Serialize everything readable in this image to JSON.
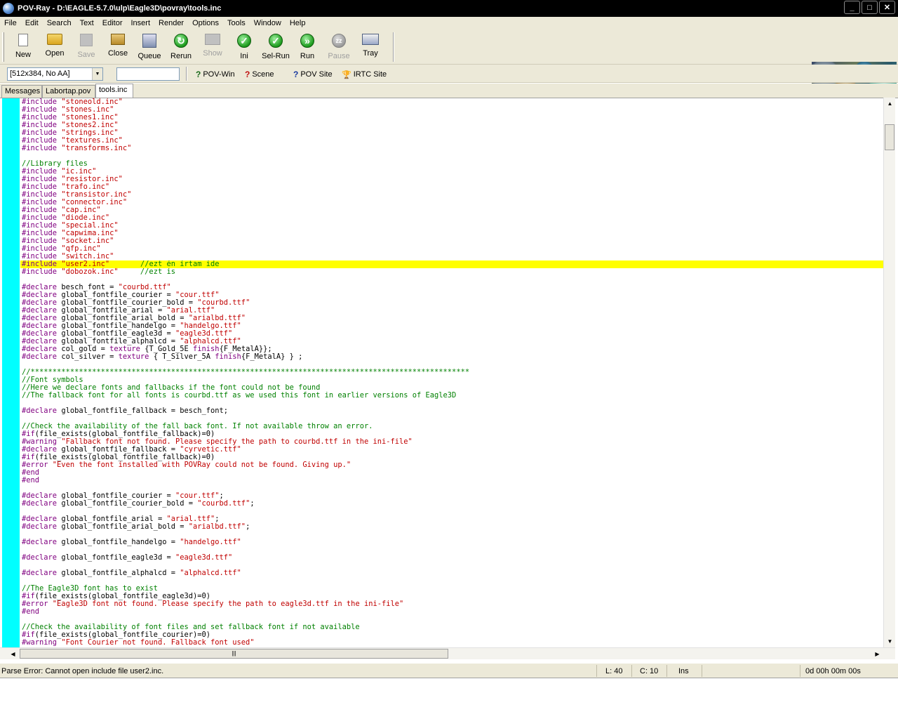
{
  "window": {
    "title": "POV-Ray - D:\\EAGLE-5.7.0\\ulp\\Eagle3D\\povray\\tools.inc",
    "controls": [
      "_",
      "□",
      "✕"
    ]
  },
  "menu": [
    "File",
    "Edit",
    "Search",
    "Text",
    "Editor",
    "Insert",
    "Render",
    "Options",
    "Tools",
    "Window",
    "Help"
  ],
  "toolbar": {
    "new": "New",
    "open": "Open",
    "save": "Save",
    "close": "Close",
    "queue": "Queue",
    "rerun": "Rerun",
    "show": "Show",
    "ini": "Ini",
    "selrun": "Sel-Run",
    "run": "Run",
    "pause": "Pause",
    "tray": "Tray"
  },
  "toolbar2": {
    "resolution": "[512x384, No AA]",
    "command_value": "",
    "povwin": "POV-Win",
    "scene": "Scene",
    "povsite": "POV Site",
    "irtcsite": "IRTC Site"
  },
  "tabs": [
    "Messages",
    "Labortap.pov",
    "tools.inc"
  ],
  "code_lines": [
    [
      [
        "kw",
        "#include "
      ],
      [
        "str",
        "\"stoneold.inc\""
      ]
    ],
    [
      [
        "kw",
        "#include "
      ],
      [
        "str",
        "\"stones.inc\""
      ]
    ],
    [
      [
        "kw",
        "#include "
      ],
      [
        "str",
        "\"stones1.inc\""
      ]
    ],
    [
      [
        "kw",
        "#include "
      ],
      [
        "str",
        "\"stones2.inc\""
      ]
    ],
    [
      [
        "kw",
        "#include "
      ],
      [
        "str",
        "\"strings.inc\""
      ]
    ],
    [
      [
        "kw",
        "#include "
      ],
      [
        "str",
        "\"textures.inc\""
      ]
    ],
    [
      [
        "kw",
        "#include "
      ],
      [
        "str",
        "\"transforms.inc\""
      ]
    ],
    [],
    [
      [
        "cmt",
        "//Library files"
      ]
    ],
    [
      [
        "kw",
        "#include "
      ],
      [
        "str",
        "\"ic.inc\""
      ]
    ],
    [
      [
        "kw",
        "#include "
      ],
      [
        "str",
        "\"resistor.inc\""
      ]
    ],
    [
      [
        "kw",
        "#include "
      ],
      [
        "str",
        "\"trafo.inc\""
      ]
    ],
    [
      [
        "kw",
        "#include "
      ],
      [
        "str",
        "\"transistor.inc\""
      ]
    ],
    [
      [
        "kw",
        "#include "
      ],
      [
        "str",
        "\"connector.inc\""
      ]
    ],
    [
      [
        "kw",
        "#include "
      ],
      [
        "str",
        "\"cap.inc\""
      ]
    ],
    [
      [
        "kw",
        "#include "
      ],
      [
        "str",
        "\"diode.inc\""
      ]
    ],
    [
      [
        "kw",
        "#include "
      ],
      [
        "str",
        "\"special.inc\""
      ]
    ],
    [
      [
        "kw",
        "#include "
      ],
      [
        "str",
        "\"capwima.inc\""
      ]
    ],
    [
      [
        "kw",
        "#include "
      ],
      [
        "str",
        "\"socket.inc\""
      ]
    ],
    [
      [
        "kw",
        "#include "
      ],
      [
        "str",
        "\"qfp.inc\""
      ]
    ],
    [
      [
        "kw",
        "#include "
      ],
      [
        "str",
        "\"switch.inc\""
      ]
    ],
    [
      [
        "kw",
        "#include "
      ],
      [
        "str",
        "\"user2.inc\""
      ],
      [
        "txt",
        "       "
      ],
      [
        "cmt",
        "//ezt én írtam ide"
      ]
    ],
    [
      [
        "kw",
        "#include "
      ],
      [
        "str",
        "\"dobozok.inc\""
      ],
      [
        "txt",
        "     "
      ],
      [
        "cmt",
        "//ezt is"
      ]
    ],
    [],
    [
      [
        "kw",
        "#declare "
      ],
      [
        "txt",
        "besch_font = "
      ],
      [
        "str",
        "\"courbd.ttf\""
      ]
    ],
    [
      [
        "kw",
        "#declare "
      ],
      [
        "txt",
        "global_fontfile_courier = "
      ],
      [
        "str",
        "\"cour.ttf\""
      ]
    ],
    [
      [
        "kw",
        "#declare "
      ],
      [
        "txt",
        "global_fontfile_courier_bold = "
      ],
      [
        "str",
        "\"courbd.ttf\""
      ]
    ],
    [
      [
        "kw",
        "#declare "
      ],
      [
        "txt",
        "global_fontfile_arial = "
      ],
      [
        "str",
        "\"arial.ttf\""
      ]
    ],
    [
      [
        "kw",
        "#declare "
      ],
      [
        "txt",
        "global_fontfile_arial_bold = "
      ],
      [
        "str",
        "\"arialbd.ttf\""
      ]
    ],
    [
      [
        "kw",
        "#declare "
      ],
      [
        "txt",
        "global_fontfile_handelgo = "
      ],
      [
        "str",
        "\"handelgo.ttf\""
      ]
    ],
    [
      [
        "kw",
        "#declare "
      ],
      [
        "txt",
        "global_fontfile_eagle3d = "
      ],
      [
        "str",
        "\"eagle3d.ttf\""
      ]
    ],
    [
      [
        "kw",
        "#declare "
      ],
      [
        "txt",
        "global_fontfile_alphalcd = "
      ],
      [
        "str",
        "\"alphalcd.ttf\""
      ]
    ],
    [
      [
        "kw",
        "#declare "
      ],
      [
        "txt",
        "col_gold = "
      ],
      [
        "kw",
        "texture "
      ],
      [
        "txt",
        "{T_Gold_5E "
      ],
      [
        "kw",
        "finish"
      ],
      [
        "txt",
        "{F_MetalA}};"
      ]
    ],
    [
      [
        "kw",
        "#declare "
      ],
      [
        "txt",
        "col_silver = "
      ],
      [
        "kw",
        "texture "
      ],
      [
        "txt",
        "{ T_Silver_5A "
      ],
      [
        "kw",
        "finish"
      ],
      [
        "txt",
        "{F_MetalA} } ;"
      ]
    ],
    [],
    [
      [
        "cmt",
        "//****************************************************************************************************"
      ]
    ],
    [
      [
        "cmt",
        "//Font symbols"
      ]
    ],
    [
      [
        "cmt",
        "//Here we declare fonts and fallbacks if the font could not be found"
      ]
    ],
    [
      [
        "cmt",
        "//The fallback font for all fonts is courbd.ttf as we used this font in earlier versions of Eagle3D"
      ]
    ],
    [],
    [
      [
        "kw",
        "#declare "
      ],
      [
        "txt",
        "global_fontfile_fallback = besch_font;"
      ]
    ],
    [],
    [
      [
        "cmt",
        "//Check the availability of the fall back font. If not available throw an error."
      ]
    ],
    [
      [
        "kw",
        "#if"
      ],
      [
        "txt",
        "(file_exists(global_fontfile_fallback)=0)"
      ]
    ],
    [
      [
        "kw",
        "#warning "
      ],
      [
        "str",
        "\"Fallback font not found. Please specify the path to courbd.ttf in the ini-file\""
      ]
    ],
    [
      [
        "kw",
        "#declare "
      ],
      [
        "txt",
        "global_fontfile_fallback = "
      ],
      [
        "str",
        "\"cyrvetic.ttf\""
      ]
    ],
    [
      [
        "kw",
        "#if"
      ],
      [
        "txt",
        "(file_exists(global_fontfile_fallback)=0)"
      ]
    ],
    [
      [
        "kw",
        "#error "
      ],
      [
        "str",
        "\"Even the font installed with POVRay could not be found. Giving up.\""
      ]
    ],
    [
      [
        "kw",
        "#end"
      ]
    ],
    [
      [
        "kw",
        "#end"
      ]
    ],
    [],
    [
      [
        "kw",
        "#declare "
      ],
      [
        "txt",
        "global_fontfile_courier = "
      ],
      [
        "str",
        "\"cour.ttf\""
      ],
      [
        "txt",
        ";"
      ]
    ],
    [
      [
        "kw",
        "#declare "
      ],
      [
        "txt",
        "global_fontfile_courier_bold = "
      ],
      [
        "str",
        "\"courbd.ttf\""
      ],
      [
        "txt",
        ";"
      ]
    ],
    [],
    [
      [
        "kw",
        "#declare "
      ],
      [
        "txt",
        "global_fontfile_arial = "
      ],
      [
        "str",
        "\"arial.ttf\""
      ],
      [
        "txt",
        ";"
      ]
    ],
    [
      [
        "kw",
        "#declare "
      ],
      [
        "txt",
        "global_fontfile_arial_bold = "
      ],
      [
        "str",
        "\"arialbd.ttf\""
      ],
      [
        "txt",
        ";"
      ]
    ],
    [],
    [
      [
        "kw",
        "#declare "
      ],
      [
        "txt",
        "global_fontfile_handelgo = "
      ],
      [
        "str",
        "\"handelgo.ttf\""
      ]
    ],
    [],
    [
      [
        "kw",
        "#declare "
      ],
      [
        "txt",
        "global_fontfile_eagle3d = "
      ],
      [
        "str",
        "\"eagle3d.ttf\""
      ]
    ],
    [],
    [
      [
        "kw",
        "#declare "
      ],
      [
        "txt",
        "global_fontfile_alphalcd = "
      ],
      [
        "str",
        "\"alphalcd.ttf\""
      ]
    ],
    [],
    [
      [
        "cmt",
        "//The Eagle3D font has to exist"
      ]
    ],
    [
      [
        "kw",
        "#if"
      ],
      [
        "txt",
        "(file_exists(global_fontfile_eagle3d)=0)"
      ]
    ],
    [
      [
        "kw",
        "#error "
      ],
      [
        "str",
        "\"Eagle3D font not found. Please specify the path to eagle3d.ttf in the ini-file\""
      ]
    ],
    [
      [
        "kw",
        "#end"
      ]
    ],
    [],
    [
      [
        "cmt",
        "//Check the availability of font files and set fallback font if not available"
      ]
    ],
    [
      [
        "kw",
        "#if"
      ],
      [
        "txt",
        "(file_exists(global_fontfile_courier)=0)"
      ]
    ],
    [
      [
        "kw",
        "#warning "
      ],
      [
        "str",
        "\"Font Courier not found. Fallback font used\""
      ]
    ]
  ],
  "highlighted_line_index": 21,
  "colors": {
    "gutter": "#00ffff",
    "highlight": "#ffff00",
    "keyword": "#800080",
    "string": "#c00000",
    "comment": "#008000"
  },
  "status": {
    "message": "Parse Error: Cannot open include file user2.inc.",
    "line": "L: 40",
    "col": "C: 10",
    "mode": "Ins",
    "time": "0d 00h 00m 00s"
  }
}
